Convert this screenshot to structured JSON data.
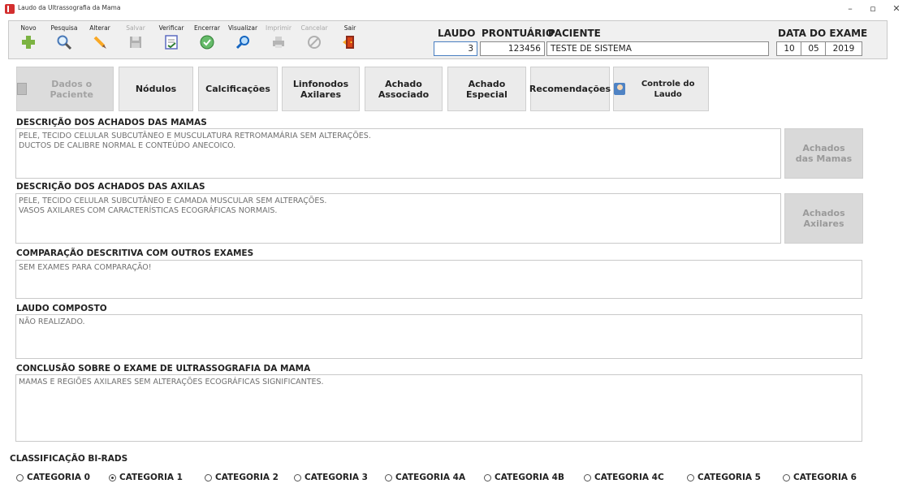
{
  "window": {
    "title": "Laudo da Ultrassografia da Mama",
    "controls": [
      "–",
      "▫",
      "✕"
    ]
  },
  "toolbar": {
    "buttons": [
      {
        "label": "Novo",
        "icon": "plus-icon",
        "enabled": true
      },
      {
        "label": "Pesquisa",
        "icon": "magnifier-icon",
        "enabled": true
      },
      {
        "label": "Alterar",
        "icon": "pencil-icon",
        "enabled": true
      },
      {
        "label": "Salvar",
        "icon": "floppy-icon",
        "enabled": false
      },
      {
        "label": "Verificar",
        "icon": "checklist-icon",
        "enabled": true
      },
      {
        "label": "Encerrar",
        "icon": "check-circle-icon",
        "enabled": true
      },
      {
        "label": "Visualizar",
        "icon": "zoom-icon",
        "enabled": true
      },
      {
        "label": "Imprimir",
        "icon": "printer-icon",
        "enabled": false
      },
      {
        "label": "Cancelar",
        "icon": "cancel-icon",
        "enabled": false
      },
      {
        "label": "Sair",
        "icon": "exit-door-icon",
        "enabled": true
      }
    ],
    "colors": {
      "plus": "#4caf50",
      "check": "#43a047",
      "exit": "#c62828"
    }
  },
  "header": {
    "laudo_label": "LAUDO",
    "laudo_value": "3",
    "prontuario_label": "PRONTUÁRIO",
    "prontuario_value": "123456",
    "paciente_label": "PACIENTE",
    "paciente_value": "TESTE DE SISTEMA",
    "data_label": "DATA DO EXAME",
    "data_day": "10",
    "data_month": "05",
    "data_year": "2019"
  },
  "tabs": [
    {
      "label": "Dados o Paciente",
      "active": true,
      "icon": "folder-icon"
    },
    {
      "label": "Nódulos",
      "active": false
    },
    {
      "label": "Calcificações",
      "active": false
    },
    {
      "label": "Linfonodos\nAxilares",
      "active": false
    },
    {
      "label": "Achado\nAssociado",
      "active": false
    },
    {
      "label": "Achado\nEspecial",
      "active": false
    },
    {
      "label": "Recomendações",
      "active": false
    },
    {
      "label": "Controle do Laudo",
      "active": false,
      "icon": "doctor-icon"
    }
  ],
  "sections": {
    "mamas": {
      "label": "DESCRIÇÃO DOS ACHADOS DAS MAMAS",
      "text": "PELE, TECIDO CELULAR SUBCUTÂNEO E MUSCULATURA RETROMAMÁRIA SEM ALTERAÇÕES.\nDUCTOS DE CALIBRE NORMAL E CONTEÚDO ANECOICO.",
      "side_button": "Achados\ndas Mamas"
    },
    "axilas": {
      "label": "DESCRIÇÃO DOS ACHADOS DAS AXILAS",
      "text": "PELE, TECIDO CELULAR SUBCUTÂNEO E CAMADA MUSCULAR SEM ALTERAÇÕES.\nVASOS AXILARES COM CARACTERÍSTICAS ECOGRÁFICAS NORMAIS.",
      "side_button": "Achados\nAxilares"
    },
    "comparacao": {
      "label": "COMPARAÇÃO DESCRITIVA COM OUTROS EXAMES",
      "text": "SEM EXAMES PARA COMPARAÇÃO!"
    },
    "composto": {
      "label": "LAUDO COMPOSTO",
      "text": "NÃO REALIZADO."
    },
    "conclusao": {
      "label": "CONCLUSÃO SOBRE O EXAME DE ULTRASSOGRAFIA DA MAMA",
      "text": "MAMAS E REGIÕES AXILARES SEM ALTERAÇÕES ECOGRÁFICAS SIGNIFICANTES."
    }
  },
  "birads": {
    "label": "CLASSIFICAÇÃO BI-RADS",
    "selected": "CATEGORIA 1",
    "options": [
      "CATEGORIA 0",
      "CATEGORIA 1",
      "CATEGORIA 2",
      "CATEGORIA 3",
      "CATEGORIA 4A",
      "CATEGORIA 4B",
      "CATEGORIA 4C",
      "CATEGORIA 5",
      "CATEGORIA 6"
    ]
  }
}
